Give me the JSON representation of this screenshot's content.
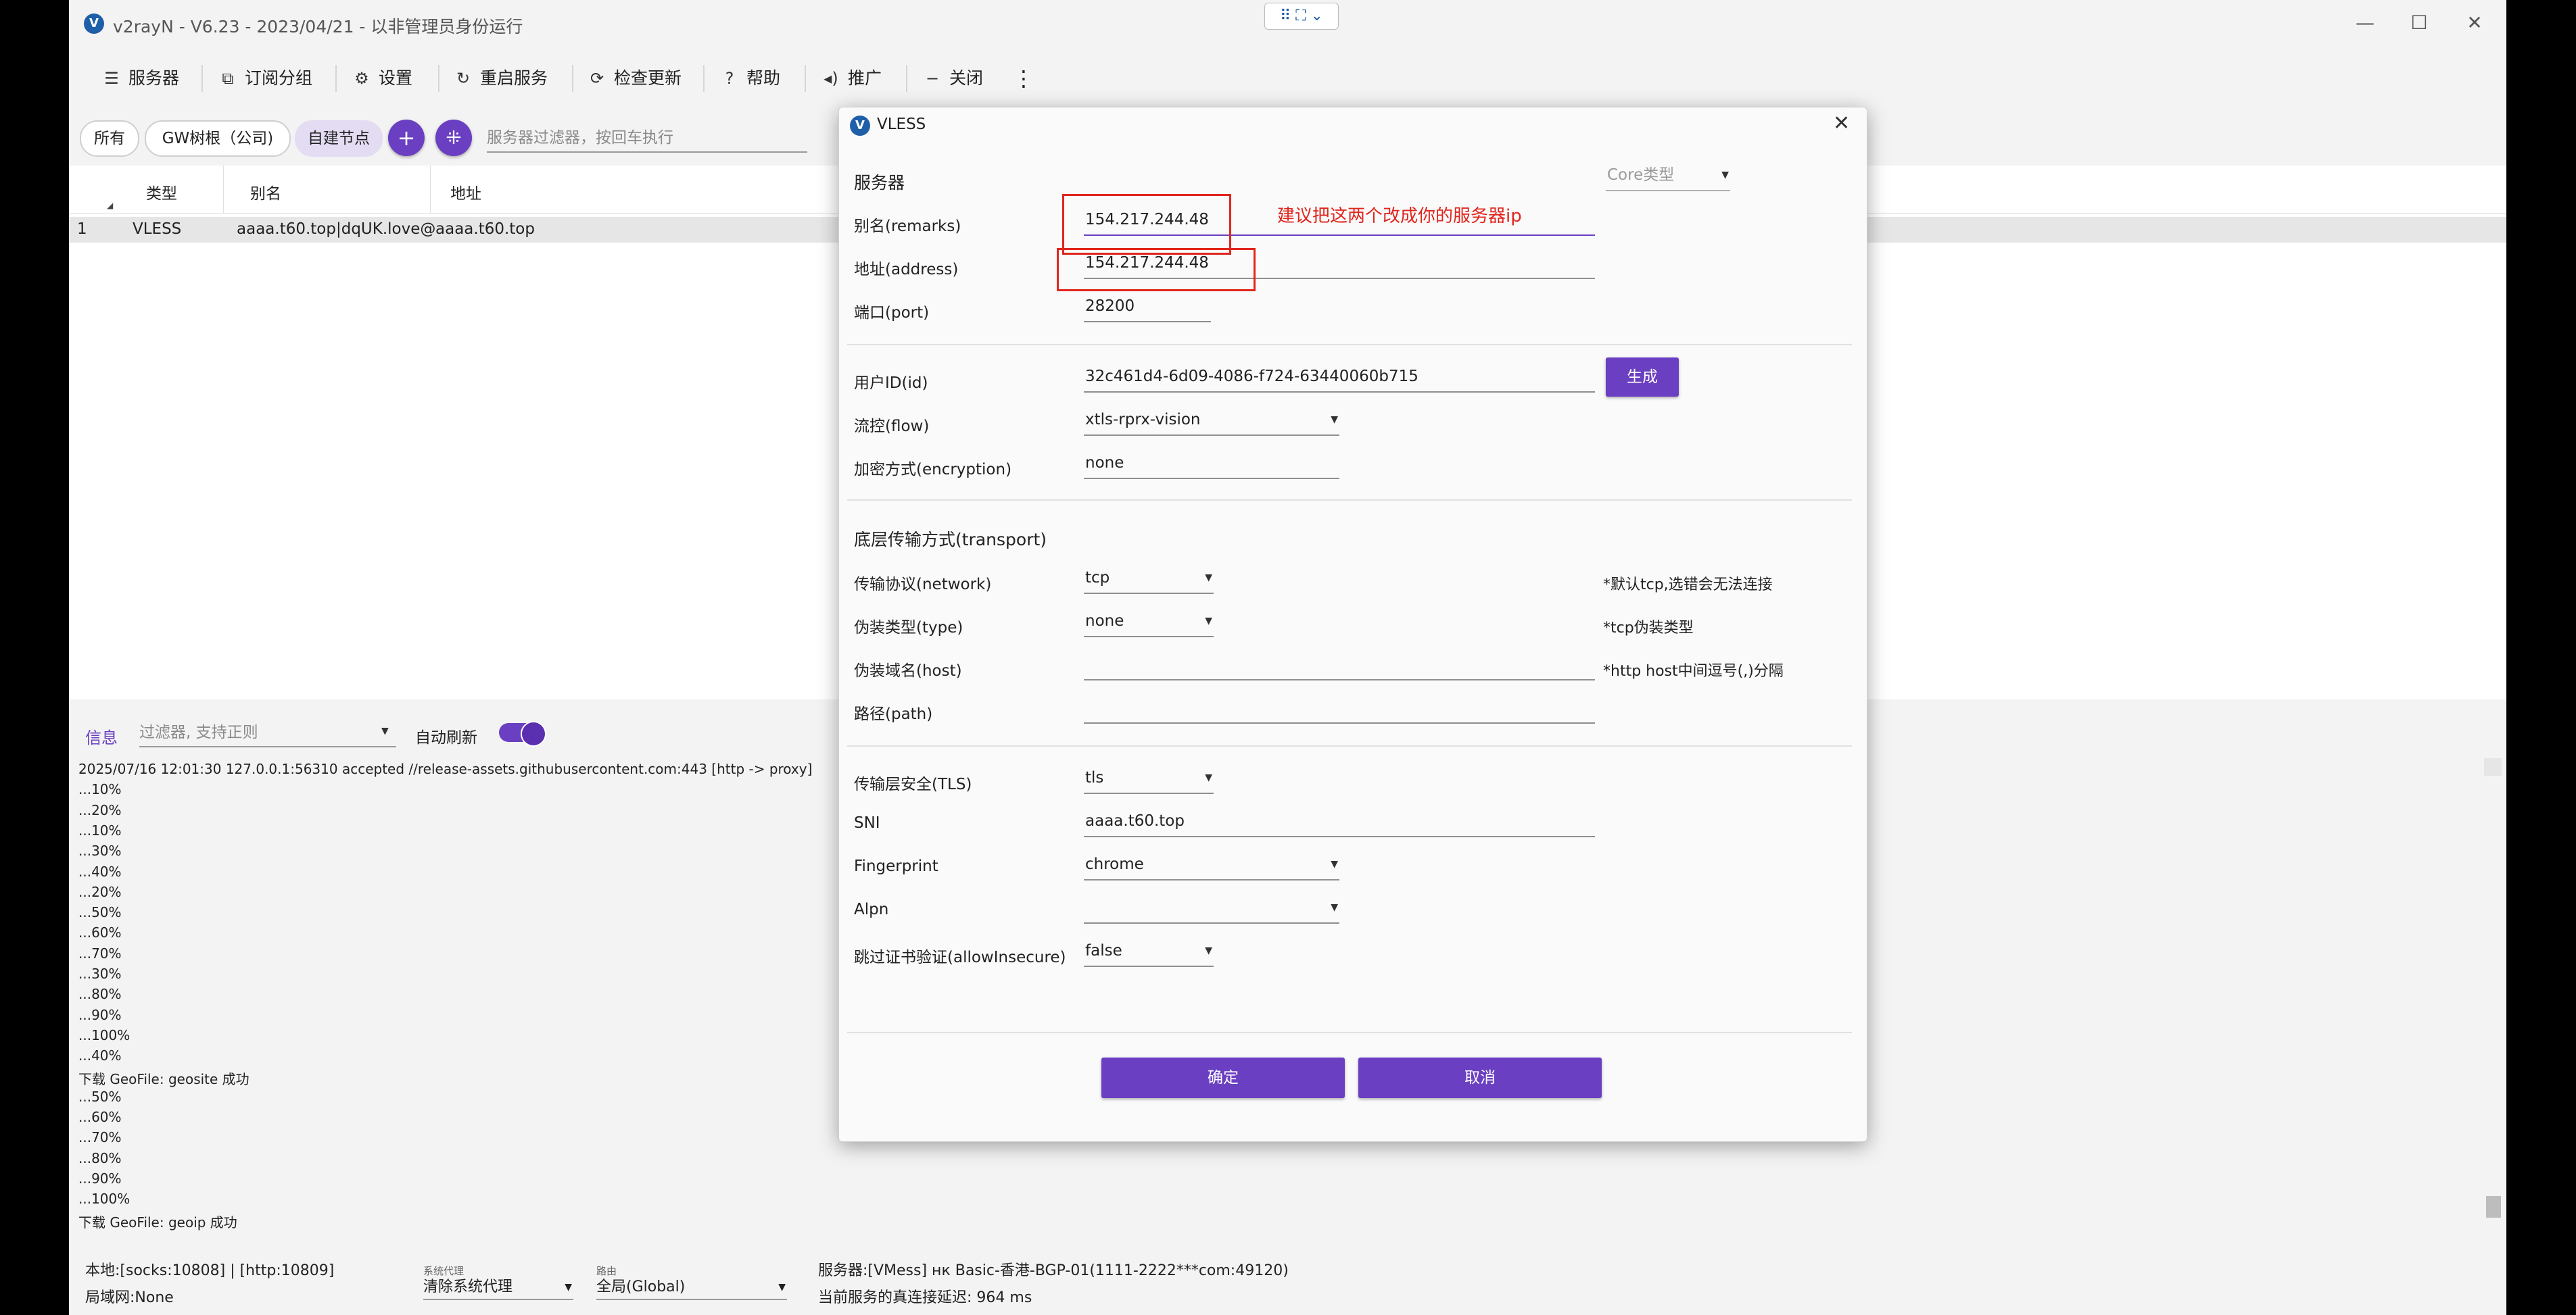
{
  "window": {
    "title": "v2rayN - V6.23 - 2023/04/21 - 以非管理员身份运行",
    "minimize": "—",
    "maximize": "☐",
    "close": "✕"
  },
  "snapbar": {
    "label": "⠿ ⛶ ⌄"
  },
  "toolbar": {
    "servers": "服务器",
    "sub_group": "订阅分组",
    "settings": "设置",
    "restart": "重启服务",
    "check_update": "检查更新",
    "help": "帮助",
    "promote": "推广",
    "close": "关闭",
    "more": "⋮"
  },
  "filters": {
    "all": "所有",
    "gw": "GW树根（公司)",
    "custom": "自建节点",
    "add": "+",
    "add2": "⁜",
    "placeholder": "服务器过滤器，按回车执行"
  },
  "grid": {
    "columns": [
      "类型",
      "别名",
      "地址"
    ],
    "row": {
      "index": "1",
      "type": "VLESS",
      "remarks": "aaaa.t60.top|dqUK.love@",
      "address": "aaaa.t60.top"
    }
  },
  "log": {
    "tab": "信息",
    "filter_placeholder": "过滤器, 支持正则",
    "auto_refresh": "自动刷新",
    "lines": [
      "2025/07/16 12:01:30 127.0.0.1:56310 accepted //release-assets.githubusercontent.com:443 [http -> proxy]",
      "...10%",
      "...20%",
      "...10%",
      "...30%",
      "...40%",
      "...20%",
      "...50%",
      "...60%",
      "...70%",
      "...30%",
      "...80%",
      "...90%",
      "...100%",
      "...40%",
      "下载 GeoFile: geosite 成功",
      "...50%",
      "...60%",
      "...70%",
      "...80%",
      "...90%",
      "...100%",
      "下载 GeoFile: geoip 成功"
    ]
  },
  "status": {
    "local": "本地:[socks:10808] | [http:10809]",
    "lan": "局域网:None",
    "sysproxy_label": "系统代理",
    "sysproxy_value": "清除系统代理",
    "routing_label": "路由",
    "routing_value": "全局(Global)",
    "server": "服务器:[VMess] нк Basic-香港-BGP-01(1111-2222***com:49120)",
    "latency": "当前服务的真连接延迟: 964 ms"
  },
  "dialog": {
    "title": "VLESS",
    "close": "✕",
    "section_server": "服务器",
    "core_type": "Core类型",
    "remarks_label": "别名(remarks)",
    "remarks_value": "154.217.244.48",
    "annotation": "建议把这两个改成你的服务器ip",
    "address_label": "地址(address)",
    "address_value": "154.217.244.48",
    "port_label": "端口(port)",
    "port_value": "28200",
    "id_label": "用户ID(id)",
    "id_value": "32c461d4-6d09-4086-f724-63440060b715",
    "generate": "生成",
    "flow_label": "流控(flow)",
    "flow_value": "xtls-rprx-vision",
    "encryption_label": "加密方式(encryption)",
    "encryption_value": "none",
    "section_transport": "底层传输方式(transport)",
    "network_label": "传输协议(network)",
    "network_value": "tcp",
    "network_note": "*默认tcp,选错会无法连接",
    "type_label": "伪装类型(type)",
    "type_value": "none",
    "type_note": "*tcp伪装类型",
    "host_label": "伪装域名(host)",
    "host_value": "",
    "host_note": "*http host中间逗号(,)分隔",
    "path_label": "路径(path)",
    "path_value": "",
    "tls_label": "传输层安全(TLS)",
    "tls_value": "tls",
    "sni_label": "SNI",
    "sni_value": "aaaa.t60.top",
    "fingerprint_label": "Fingerprint",
    "fingerprint_value": "chrome",
    "alpn_label": "Alpn",
    "alpn_value": "",
    "insecure_label": "跳过证书验证(allowInsecure)",
    "insecure_value": "false",
    "ok": "确定",
    "cancel": "取消"
  },
  "colors": {
    "accent": "#6a3fc1",
    "annotation": "#e0251d"
  }
}
